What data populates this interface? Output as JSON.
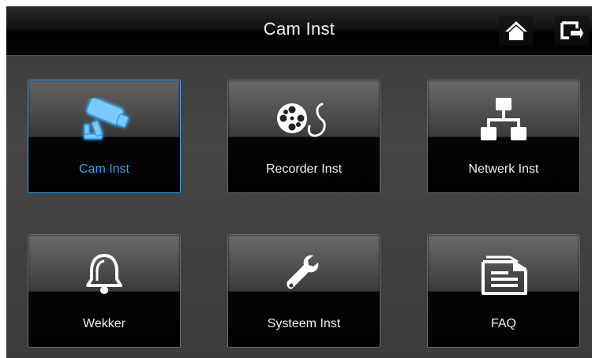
{
  "header": {
    "title": "Cam Inst",
    "home_icon": "home-icon",
    "back_icon": "back-exit-icon"
  },
  "tiles": [
    {
      "label": "Cam Inst",
      "icon": "camera-icon",
      "selected": true
    },
    {
      "label": "Recorder Inst",
      "icon": "film-reel-icon",
      "selected": false
    },
    {
      "label": "Netwerk Inst",
      "icon": "network-icon",
      "selected": false
    },
    {
      "label": "Wekker",
      "icon": "bell-alarm-icon",
      "selected": false
    },
    {
      "label": "Systeem Inst",
      "icon": "wrench-icon",
      "selected": false
    },
    {
      "label": "FAQ",
      "icon": "document-icon",
      "selected": false
    }
  ],
  "colors": {
    "accent": "#35a6ee",
    "background": "#3f3f3f",
    "header": "#000000",
    "text": "#f0f0f0"
  }
}
